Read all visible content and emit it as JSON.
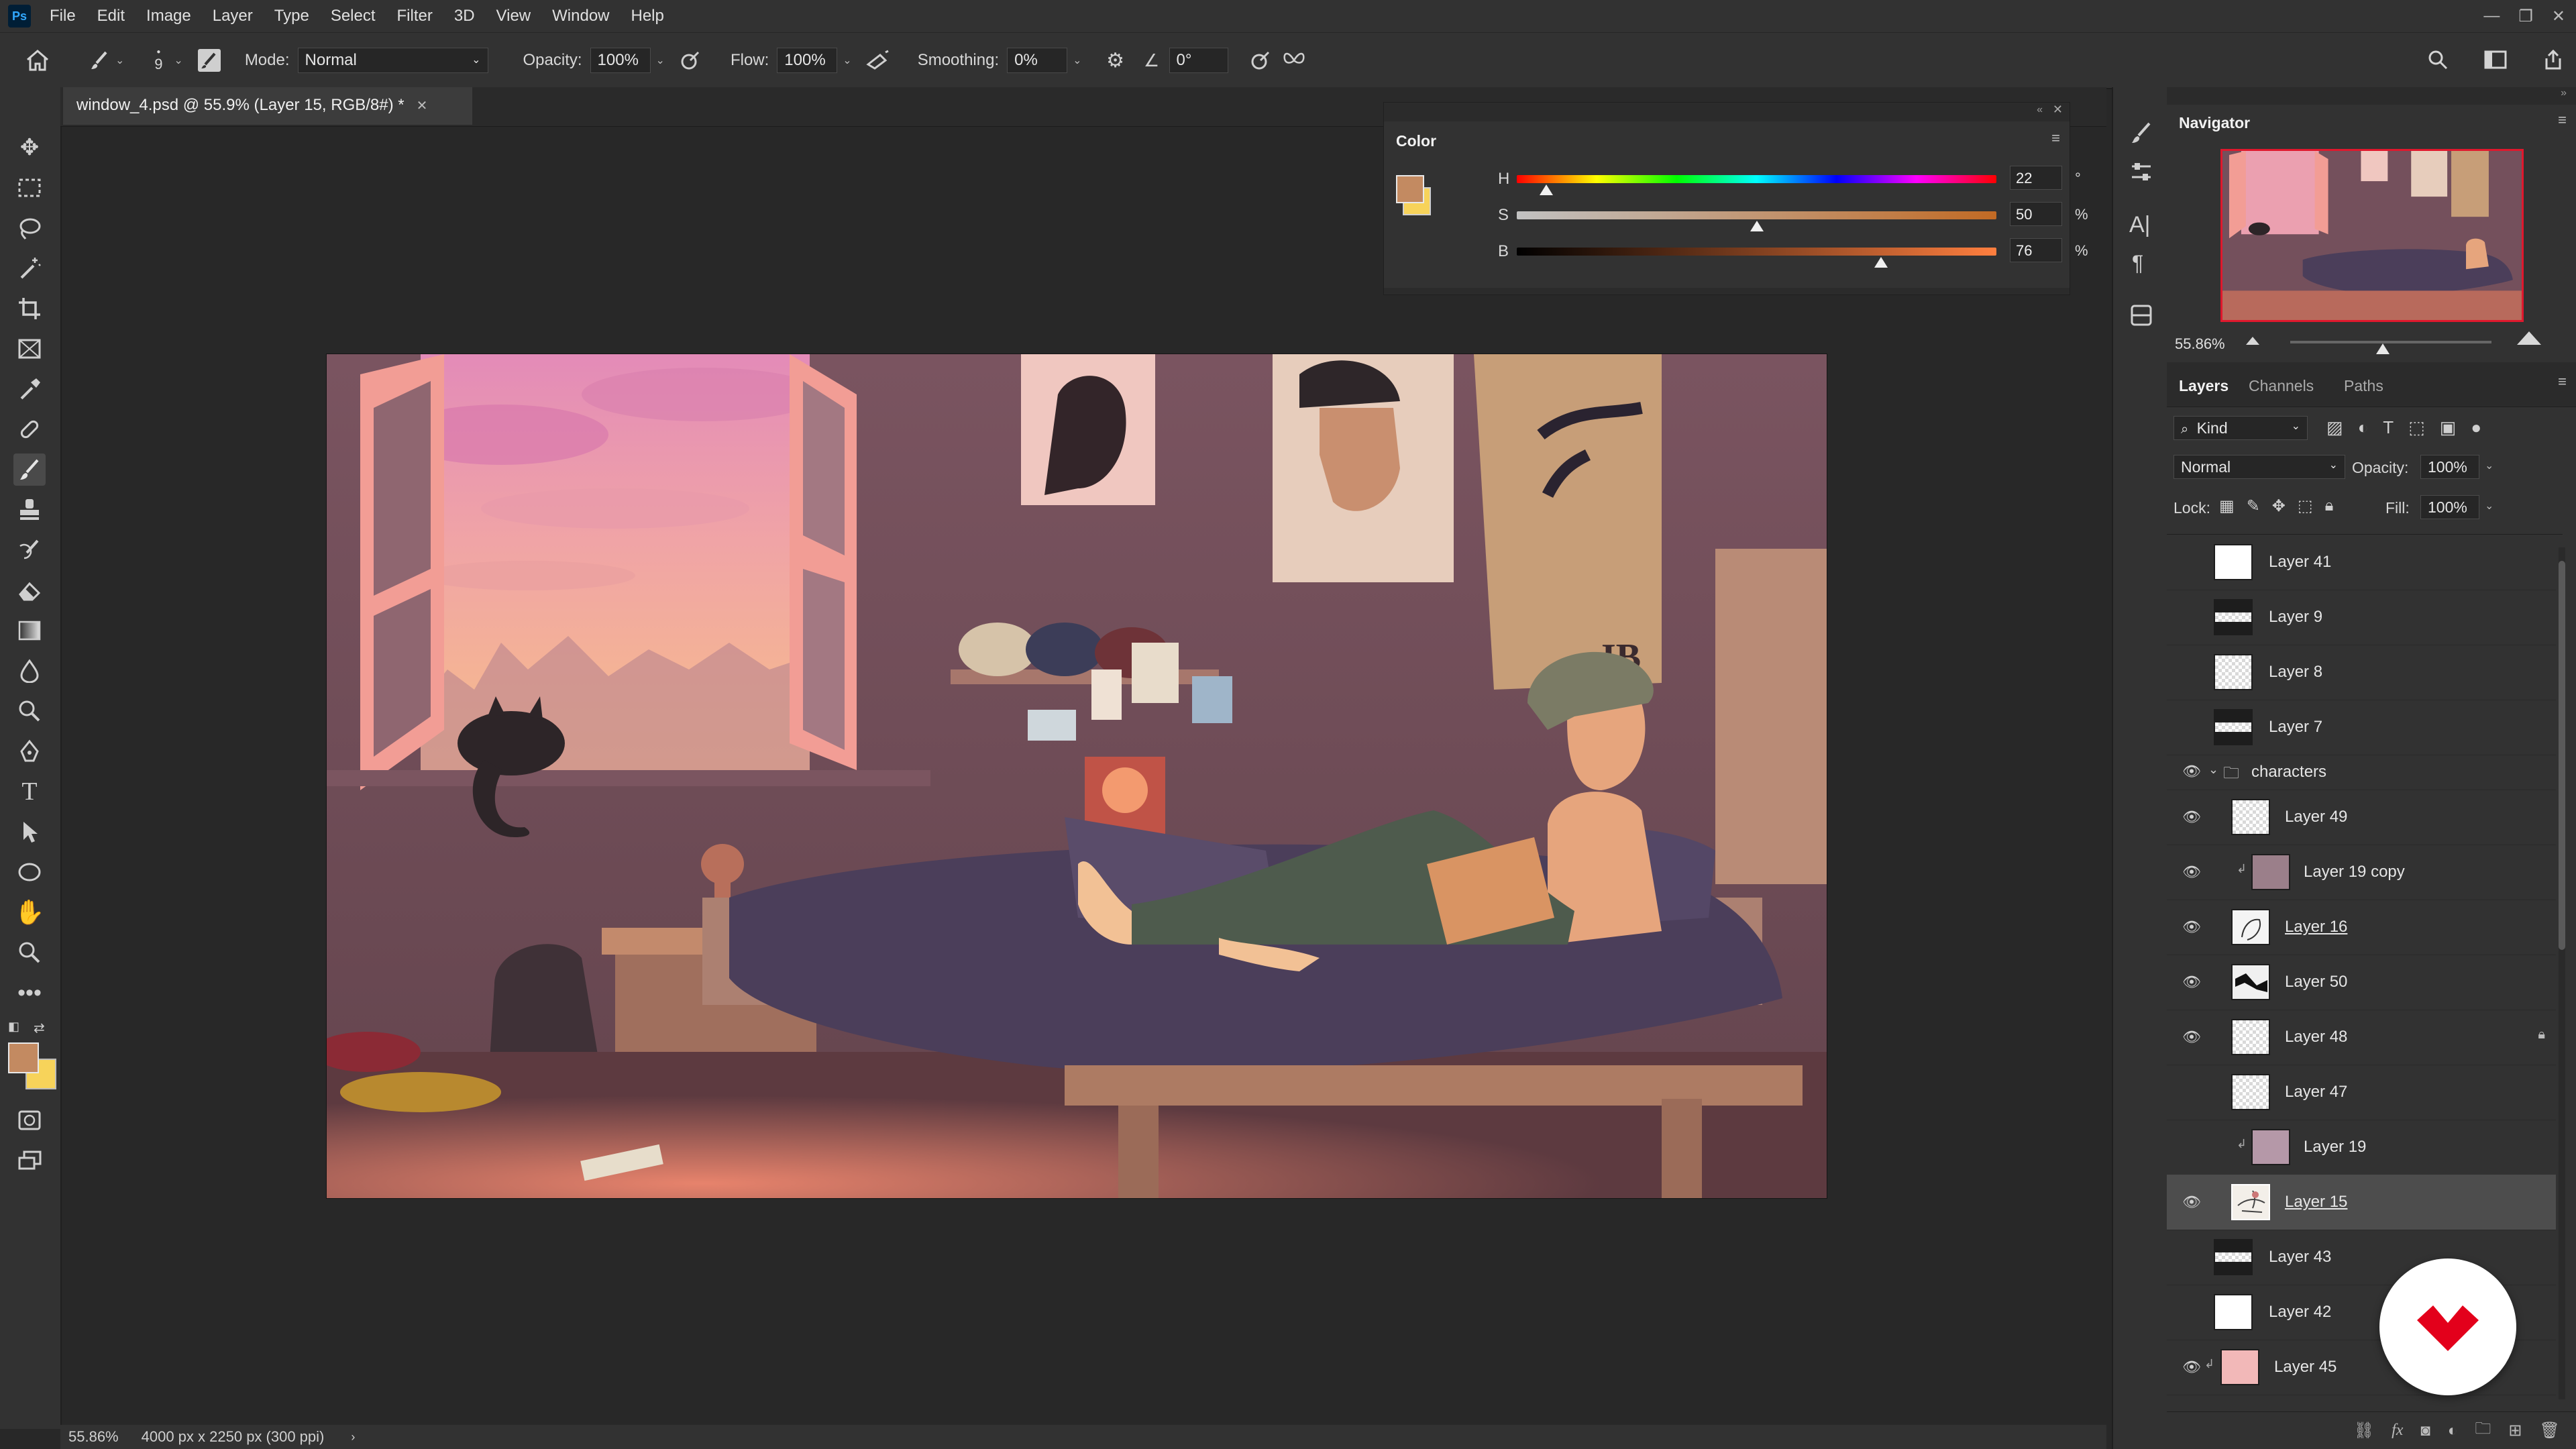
{
  "app": {
    "logo_text": "Ps",
    "menu": [
      "File",
      "Edit",
      "Image",
      "Layer",
      "Type",
      "Select",
      "Filter",
      "3D",
      "View",
      "Window",
      "Help"
    ]
  },
  "options": {
    "brush_size": "9",
    "mode_label": "Mode:",
    "mode_value": "Normal",
    "opacity_label": "Opacity:",
    "opacity_value": "100%",
    "flow_label": "Flow:",
    "flow_value": "100%",
    "smoothing_label": "Smoothing:",
    "smoothing_value": "0%",
    "angle_value": "0°"
  },
  "document": {
    "tab_title": "window_4.psd @ 55.9% (Layer 15, RGB/8#) *",
    "zoom": "55.86%",
    "dimensions": "4000 px x 2250 px (300 ppi)"
  },
  "color_panel": {
    "title": "Color",
    "foreground": "#c38a61",
    "background": "#f7d35a",
    "h_label": "H",
    "h_value": "22",
    "h_unit": "°",
    "s_label": "S",
    "s_value": "50",
    "s_unit": "%",
    "b_label": "B",
    "b_value": "76",
    "b_unit": "%"
  },
  "navigator": {
    "title": "Navigator",
    "zoom": "55.86%",
    "zoom_level": 0.5586
  },
  "layers_panel": {
    "tabs": [
      "Layers",
      "Channels",
      "Paths"
    ],
    "kind_label": "Kind",
    "blend_mode": "Normal",
    "opacity_label": "Opacity:",
    "opacity_value": "100%",
    "lock_label": "Lock:",
    "fill_label": "Fill:",
    "fill_value": "100%",
    "layers": [
      {
        "name": "Layer 41",
        "visible": false,
        "thumb": "white"
      },
      {
        "name": "Layer 9",
        "visible": false,
        "thumb": "stripe"
      },
      {
        "name": "Layer 8",
        "visible": false,
        "thumb": "checker"
      },
      {
        "name": "Layer 7",
        "visible": false,
        "thumb": "stripe"
      },
      {
        "name": "characters",
        "visible": true,
        "thumb": "folder"
      },
      {
        "name": "Layer 49",
        "visible": true,
        "thumb": "checker"
      },
      {
        "name": "Layer 19 copy",
        "visible": true,
        "thumb": "mauve"
      },
      {
        "name": "Layer 16",
        "visible": true,
        "thumb": "sketch"
      },
      {
        "name": "Layer 50",
        "visible": true,
        "thumb": "dark"
      },
      {
        "name": "Layer 48",
        "visible": true,
        "thumb": "checker",
        "locked": true
      },
      {
        "name": "Layer 47",
        "visible": false,
        "thumb": "checker"
      },
      {
        "name": "Layer 19",
        "visible": false,
        "thumb": "mauve"
      },
      {
        "name": "Layer 15",
        "visible": true,
        "thumb": "sketch",
        "selected": true
      },
      {
        "name": "Layer 43",
        "visible": false,
        "thumb": "stripe"
      },
      {
        "name": "Layer 42",
        "visible": false,
        "thumb": "white"
      },
      {
        "name": "Layer 45",
        "visible": true,
        "thumb": "pink"
      }
    ]
  }
}
